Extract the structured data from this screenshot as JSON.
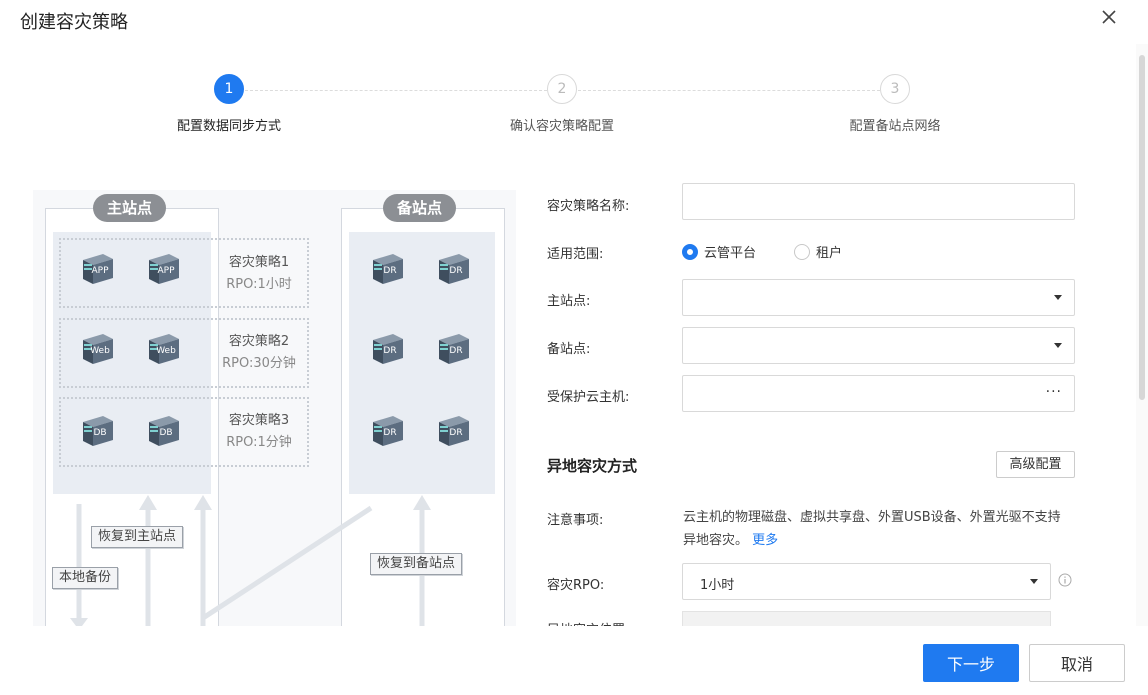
{
  "dialog": {
    "title": "创建容灾策略"
  },
  "steps": [
    {
      "num": "1",
      "label": "配置数据同步方式"
    },
    {
      "num": "2",
      "label": "确认容灾策略配置"
    },
    {
      "num": "3",
      "label": "配置备站点网络"
    }
  ],
  "diagram": {
    "main_site": "主站点",
    "backup_site": "备站点",
    "policies": [
      {
        "name": "容灾策略1",
        "rpo": "RPO:1小时",
        "server_label": "APP"
      },
      {
        "name": "容灾策略2",
        "rpo": "RPO:30分钟",
        "server_label": "Web"
      },
      {
        "name": "容灾策略3",
        "rpo": "RPO:1分钟",
        "server_label": "DB"
      }
    ],
    "dr_label": "DR",
    "restore_to_main": "恢复到主站点",
    "local_backup": "本地备份",
    "restore_to_backup": "恢复到备站点"
  },
  "form": {
    "policy_name_label": "容灾策略名称:",
    "scope_label": "适用范围:",
    "scope_options": [
      "云管平台",
      "租户"
    ],
    "main_site_label": "主站点:",
    "backup_site_label": "备站点:",
    "protected_vm_label": "受保护云主机:",
    "ellipsis": "···",
    "section_title": "异地容灾方式",
    "advanced_button": "高级配置",
    "note_label": "注意事项:",
    "note_text": "云主机的物理磁盘、虚拟共享盘、外置USB设备、外置光驱不支持异地容灾。",
    "note_more": "更多",
    "rpo_label": "容灾RPO:",
    "rpo_value": "1小时",
    "cut_label": "异地容灾位置"
  },
  "footer": {
    "next": "下一步",
    "cancel": "取消"
  },
  "colors": {
    "primary": "#1f7af0"
  }
}
